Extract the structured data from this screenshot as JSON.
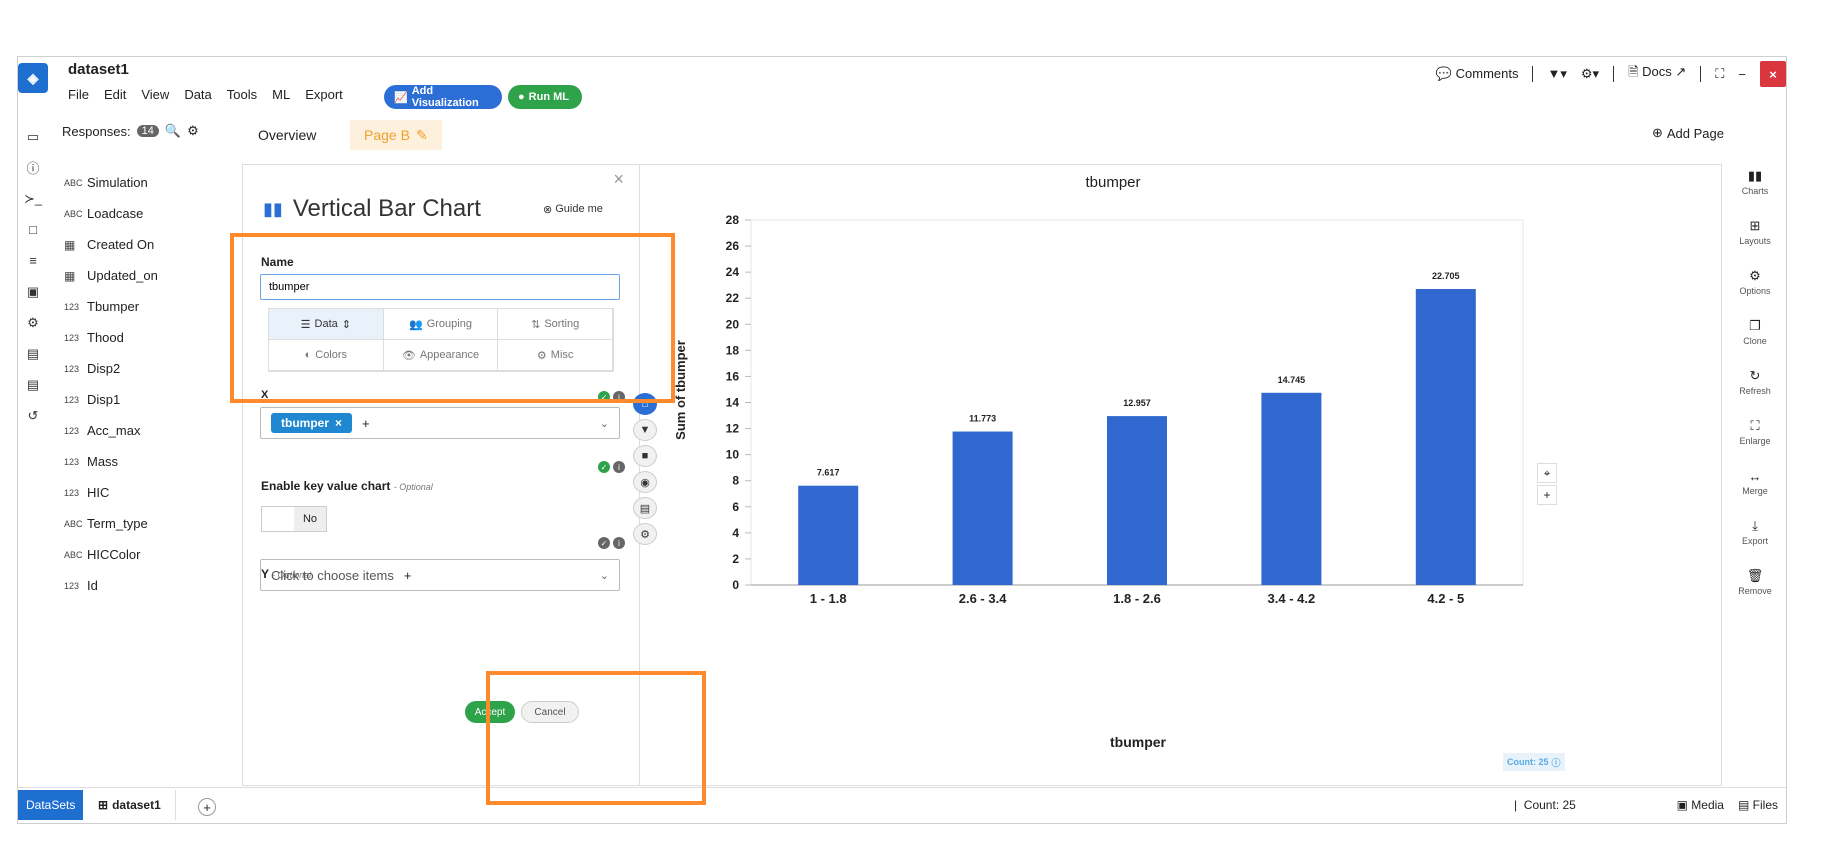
{
  "app": {
    "title": "dataset1",
    "menu": [
      "File",
      "Edit",
      "View",
      "Data",
      "Tools",
      "ML",
      "Export"
    ],
    "add_visualization": "Add Visualization",
    "run_ml": "Run ML",
    "comments": "Comments",
    "docs": "Docs",
    "close": "×"
  },
  "fields": {
    "header": "Responses:",
    "count": "14",
    "items": [
      {
        "type": "ABC",
        "name": "Simulation"
      },
      {
        "type": "ABC",
        "name": "Loadcase"
      },
      {
        "type": "cal",
        "name": "Created On"
      },
      {
        "type": "cal",
        "name": "Updated_on"
      },
      {
        "type": "123",
        "name": "Tbumper"
      },
      {
        "type": "123",
        "name": "Thood"
      },
      {
        "type": "123",
        "name": "Disp2"
      },
      {
        "type": "123",
        "name": "Disp1"
      },
      {
        "type": "123",
        "name": "Acc_max"
      },
      {
        "type": "123",
        "name": "Mass"
      },
      {
        "type": "123",
        "name": "HIC"
      },
      {
        "type": "ABC",
        "name": "Term_type"
      },
      {
        "type": "ABC",
        "name": "HICColor"
      },
      {
        "type": "123",
        "name": "Id"
      }
    ]
  },
  "tabs": {
    "overview": "Overview",
    "page_b": "Page B",
    "add_page": "Add Page"
  },
  "config": {
    "title": "Vertical Bar Chart",
    "guide": "Guide me",
    "name_label": "Name",
    "name_value": "tbumper",
    "subtabs": [
      "Data",
      "Grouping",
      "Sorting",
      "Colors",
      "Appearance",
      "Misc"
    ],
    "x_label": "X",
    "x_chip": "tbumper",
    "kv_label": "Enable key value chart",
    "optional": "- Optional",
    "toggle_label": "No",
    "y_label": "Y",
    "y_placeholder": "Click to choose items",
    "accept": "Accept",
    "cancel": "Cancel"
  },
  "chart_data": {
    "type": "bar",
    "title": "tbumper",
    "xlabel": "tbumper",
    "ylabel": "Sum of tbumper",
    "categories": [
      "1 - 1.8",
      "2.6 - 3.4",
      "1.8 - 2.6",
      "3.4 - 4.2",
      "4.2 - 5"
    ],
    "values": [
      7.617,
      11.773,
      12.957,
      14.745,
      22.705
    ],
    "value_labels": [
      "7.617",
      "11.773",
      "12.957",
      "14.745",
      "22.705"
    ],
    "ylim": [
      0,
      28
    ],
    "yticks": [
      0,
      2,
      4,
      6,
      8,
      10,
      12,
      14,
      16,
      18,
      20,
      22,
      24,
      26,
      28
    ],
    "bar_color": "#3068d0",
    "grid": false
  },
  "chart_badge": "Count: 25",
  "right_rail": [
    "Charts",
    "Layouts",
    "Options",
    "Clone",
    "Refresh",
    "Enlarge",
    "Merge",
    "Export",
    "Remove"
  ],
  "bottom": {
    "datasets": "DataSets",
    "dataset_tab": "dataset1",
    "count": "Count: 25",
    "media": "Media",
    "files": "Files"
  }
}
